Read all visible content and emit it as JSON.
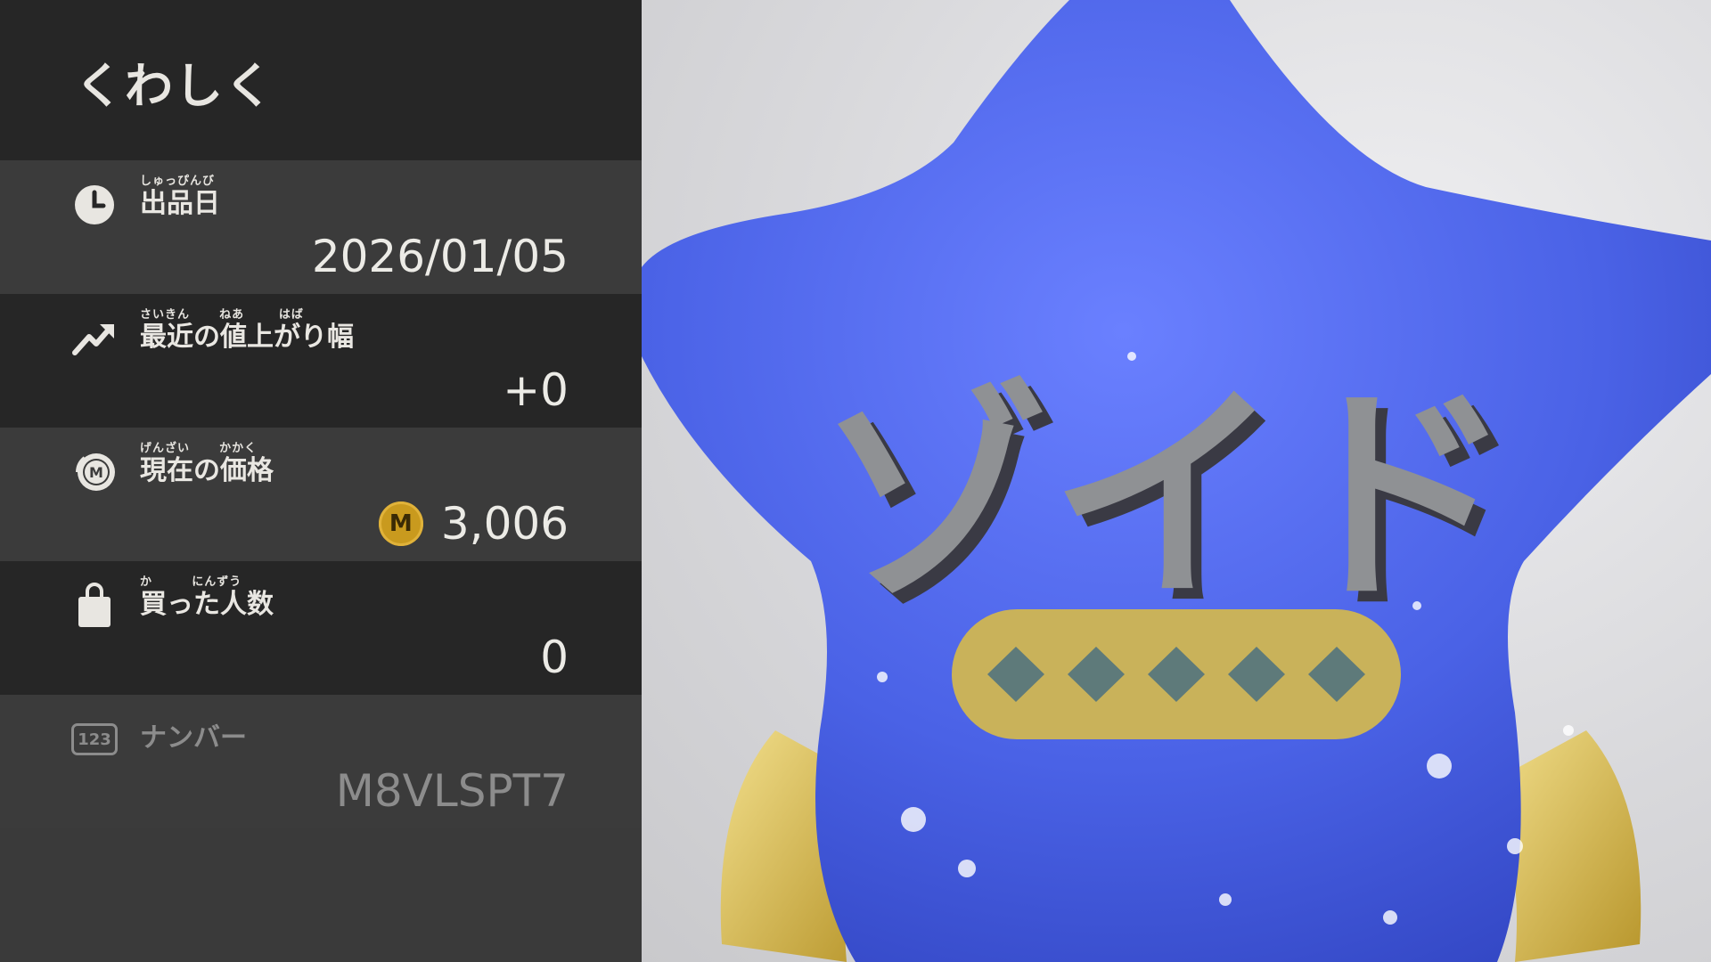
{
  "header": {
    "title": "くわしく"
  },
  "details": [
    {
      "icon": "clock-icon",
      "ruby": "しゅっぴんび",
      "label": "出品日",
      "value": "2026/01/05"
    },
    {
      "icon": "trend-up-arrow-icon",
      "ruby": "さいきん      ねあ       はば",
      "label": "最近の値上がり幅",
      "value": "+0"
    },
    {
      "icon": "medal-coin-icon",
      "ruby": "げんざい      かかく",
      "label": "現在の価格",
      "value": "3,006",
      "currency_symbol": "M"
    },
    {
      "icon": "shopping-bag-icon",
      "ruby": "か        にんずう",
      "label": "買った人数",
      "value": "0"
    },
    {
      "icon": "number-123-icon",
      "icon_text": "123",
      "ruby": "",
      "label": "ナンバー",
      "value": "M8VLSPT7"
    }
  ],
  "item": {
    "name_text": "ゾイド",
    "colors": {
      "star": "#4a62e6",
      "band": "#c9b25a",
      "diamond": "#5e7a7a",
      "lettering": "#8f9194"
    }
  }
}
